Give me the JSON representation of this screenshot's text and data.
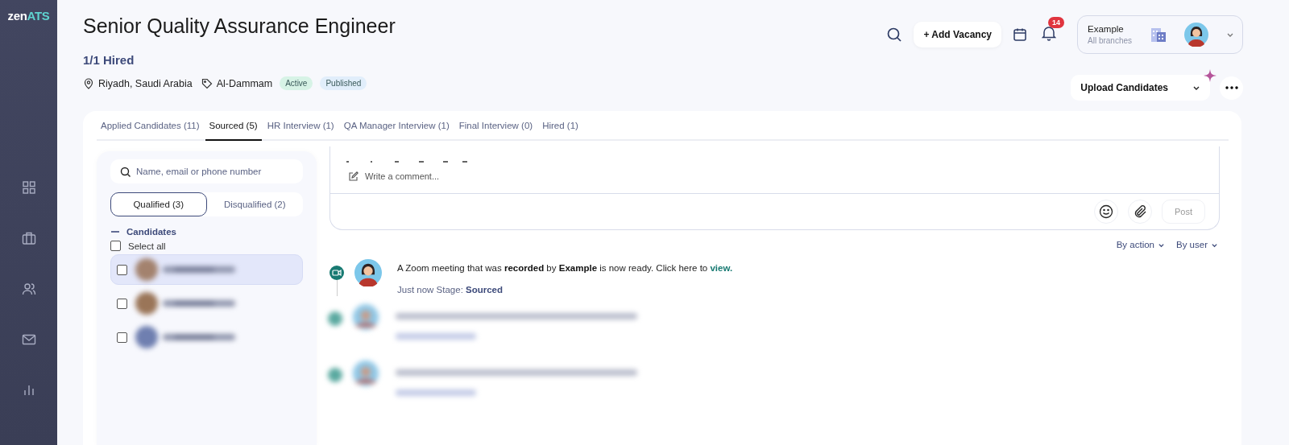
{
  "logo": {
    "part1": "zen",
    "part2": "ATS"
  },
  "nav": [
    {
      "kind": "grid",
      "selected": false
    },
    {
      "kind": "briefcase",
      "selected": false
    },
    {
      "kind": "people",
      "selected": false
    },
    {
      "kind": "mail",
      "selected": false
    },
    {
      "kind": "chart",
      "selected": false
    }
  ],
  "title": "Senior Quality Assurance Engineer",
  "hired": "1/1 Hired",
  "location": "Riyadh, Saudi Arabia",
  "branch": "Al-Dammam",
  "badges": [
    {
      "label": "Active",
      "color": "#d7f3e6"
    },
    {
      "label": "Published",
      "color": "#e1eefb"
    }
  ],
  "header": {
    "add_button": "+ Add Vacancy",
    "notifications": "14",
    "account": {
      "name": "Example",
      "sub": "All branches"
    }
  },
  "upload_button": "Upload Candidates",
  "tabs": [
    {
      "label": "Applied Candidates (11)",
      "selected": false
    },
    {
      "label": "Sourced (5)",
      "selected": true
    },
    {
      "label": "HR Interview (1)",
      "selected": false
    },
    {
      "label": "QA Manager Interview (1)",
      "selected": false
    },
    {
      "label": "Final Interview (0)",
      "selected": false
    },
    {
      "label": "Hired (1)",
      "selected": false
    }
  ],
  "search": {
    "placeholder": "Name, email or phone number"
  },
  "filters": [
    {
      "label": "Qualified (3)",
      "selected": true
    },
    {
      "label": "Disqualified (2)",
      "selected": false
    }
  ],
  "candidates_heading": "Candidates",
  "select_all": {
    "label": "Select all",
    "checked": false
  },
  "candidates": [
    {
      "checked": false,
      "selected": true
    },
    {
      "checked": false,
      "selected": false
    },
    {
      "checked": false,
      "selected": false
    }
  ],
  "comment": {
    "placeholder": "Write a comment...",
    "post": "Post"
  },
  "filters_right": [
    "By action",
    "By user"
  ],
  "events": [
    {
      "kind": "zoom",
      "message": "A Zoom meeting that was **recorded** by **Example** is now ready. Click here to ",
      "link": "view.",
      "meta": "Just now Stage: **Sourced**"
    },
    {
      "kind": "blurred"
    },
    {
      "kind": "blurred"
    }
  ]
}
